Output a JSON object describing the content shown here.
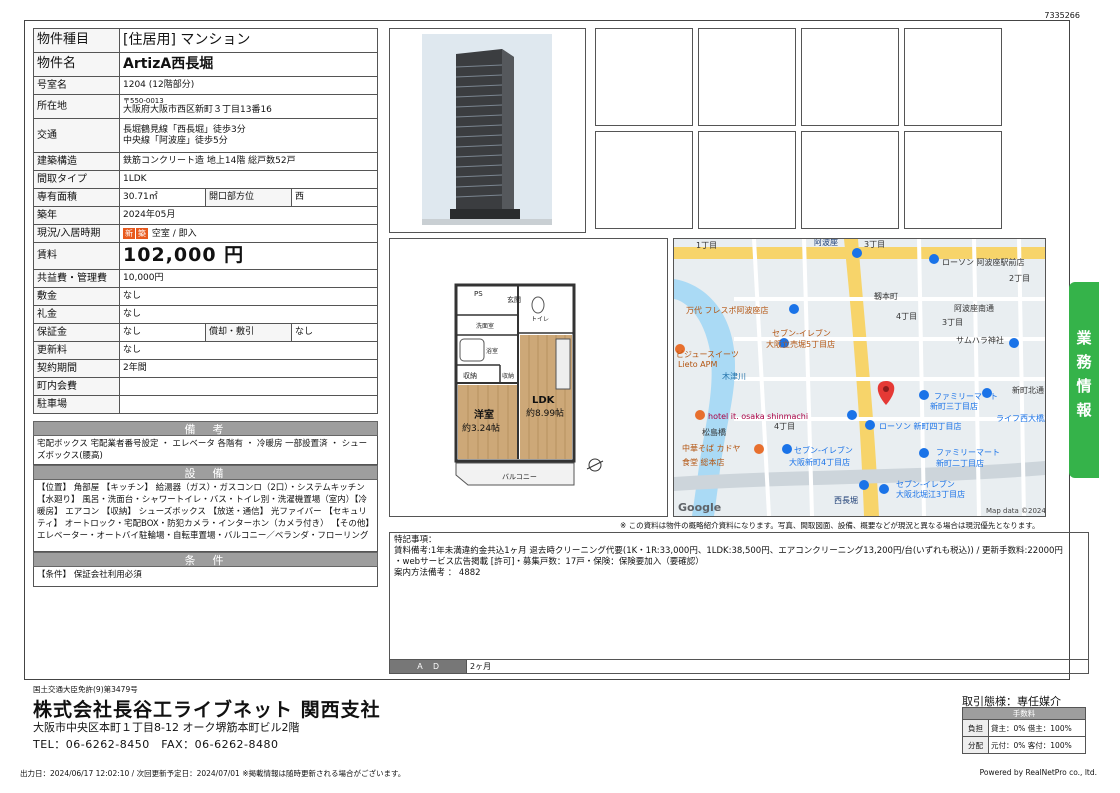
{
  "property_id": "7335266",
  "info": {
    "type_label": "物件種目",
    "type_value": "[住居用] マンション",
    "name_label": "物件名",
    "name_value": "ArtizA西長堀",
    "room_label": "号室名",
    "room_value": "1204 (12階部分)",
    "location_label": "所在地",
    "zip": "〒550-0013",
    "address": "大阪府大阪市西区新町３丁目13番16",
    "transit_label": "交通",
    "transit1": "長堀鶴見線「西長堀」徒歩3分",
    "transit2": "中央線「阿波座」徒歩5分",
    "structure_label": "建築構造",
    "structure_value": "鉄筋コンクリート造 地上14階 総戸数52戸",
    "layout_label": "間取タイプ",
    "layout_value": "1LDK",
    "area_label": "専有面積",
    "area_value": "30.71㎡",
    "facing_label": "開口部方位",
    "facing_value": "西",
    "built_label": "築年",
    "built_value": "2024年05月",
    "status_label": "現況/入居時期",
    "status_badge1": "新",
    "status_badge2": "築",
    "status_value": "空室 / 即入",
    "rent_label": "賃料",
    "rent_value": "102,000 円",
    "fee_label": "共益費・管理費",
    "fee_value": "10,000円",
    "deposit_label": "敷金",
    "deposit_value": "なし",
    "key_label": "礼金",
    "key_value": "なし",
    "guarantee_label": "保証金",
    "guarantee_value": "なし",
    "amort_label": "償却・敷引",
    "amort_value": "なし",
    "renew_label": "更新料",
    "renew_value": "なし",
    "contract_label": "契約期間",
    "contract_value": "2年間",
    "town_label": "町内会費",
    "town_value": "",
    "parking_label": "駐車場",
    "parking_value": ""
  },
  "remarks_section": {
    "title": "備　考",
    "text": "宅配ボックス 宅配業者番号設定 ・ エレベータ 各階有 ・ 冷暖房 一部設置済 ・ シューズボックス(腰高)"
  },
  "equipment_section": {
    "title": "設　備",
    "text": "【位置】 角部屋 【キッチン】 給湯器（ガス）・ガスコンロ（2口）・システムキッチン 【水廻り】 風呂・洗面台・シャワートイレ・バス・トイレ別・洗濯機置場（室内）【冷暖房】 エアコン 【収納】 シューズボックス 【放送・通信】 光ファイバー 【セキュリティ】 オートロック・宅配BOX・防犯カメラ・インターホン（カメラ付き） 【その他】 エレベーター・オートバイ駐輪場・自転車置場・バルコニー／ベランダ・フローリング"
  },
  "conditions_section": {
    "title": "条　件",
    "text": "【条件】 保証会社利用必須"
  },
  "floorplan": {
    "ps": "PS",
    "entrance": "玄関",
    "washroom": "洗面室",
    "toilet": "トイレ",
    "bath": "浴室",
    "storage": "収納",
    "storage2": "収納",
    "ldk": "LDK",
    "ldk_size": "約8.99帖",
    "western": "洋室",
    "western_size": "約3.24帖",
    "balcony": "バルコニー"
  },
  "map": {
    "labels": [
      "阿波座",
      "1丁目",
      "3丁目",
      "ローソン 阿波座駅前店",
      "2丁目",
      "靱本町",
      "阿波座南通",
      "万代 フレスポ阿波座店",
      "4丁目",
      "3丁目",
      "セブン-イレブン",
      "大阪立売堀5丁目店",
      "サムハラ神社",
      "ビジュースイーツ",
      "Lieto APM",
      "木津川",
      "新町北通",
      "ファミリーマート",
      "新町三丁目店",
      "ライフ西大橋店",
      "hotel it. osaka shinmachi",
      "松島橋",
      "4丁目",
      "ローソン 新町四丁目店",
      "中華そば カドヤ",
      "食堂 総本店",
      "セブン-イレブン",
      "大阪新町4丁目店",
      "ファミリーマート",
      "新町二丁目店",
      "西長堀",
      "セブン-イレブン",
      "大阪北堀江3丁目店",
      "Google",
      "Map data ©2024"
    ]
  },
  "disclaimer": "※ この資料は物件の概略紹介資料になります。写真、間取図面、設備、概要などが現況と異なる場合は現況優先となります。",
  "special_notes": {
    "line1": "特記事項：",
    "line2": "賃料備考:1年未満違約金共込1ヶ月 退去時クリーニング代要(1K・1R:33,000円、1LDK:38,500円、エアコンクリーニング13,200円/台(いずれも税込)) / 更新手数料:22000円",
    "line3": "・webサービス広告掲載 [許可]・募集戸数：17戸・保険：保険要加入（要確認）",
    "line4": "案内方法備考 ： 4882"
  },
  "ad": {
    "label": "Ａ　Ｄ",
    "value": "2ヶ月"
  },
  "sidetab": [
    "業",
    "務",
    "情",
    "報"
  ],
  "company": {
    "license": "国土交通大臣免許(9)第3479号",
    "name": "株式会社長谷工ライブネット 関西支社",
    "address": "大阪市中央区本町１丁目8-12 オーク堺筋本町ビル2階",
    "tel": "TEL：06-6262-8450　FAX：06-6262-8480"
  },
  "fee_box": {
    "mode": "取引態様：専任媒介",
    "header": "手数料",
    "row1_label": "負担",
    "row1_value": "貸主：0%  借主：100%",
    "row2_label": "分配",
    "row2_value": "元付：0%  客付：100%"
  },
  "footer": {
    "left": "出力日：2024/06/17 12:02:10 / 次回更新予定日：2024/07/01 ※掲載情報は随時更新される場合がございます。",
    "right": "Powered by RealNetPro co., ltd."
  },
  "colors": {
    "accent_green": "#35b34a",
    "section_gray": "#9e9e9e",
    "badge_orange": "#e85a1e"
  }
}
